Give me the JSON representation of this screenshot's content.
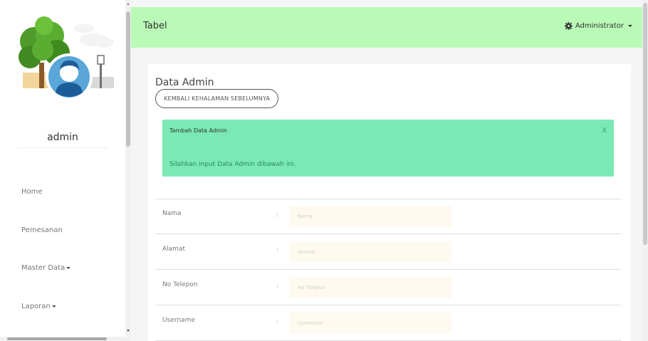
{
  "sidebar": {
    "profile_name": "admin",
    "nav": [
      {
        "label": "Home",
        "has_caret": false
      },
      {
        "label": "Pemesanan",
        "has_caret": false
      },
      {
        "label": "Master Data",
        "has_caret": true
      },
      {
        "label": "Laporan",
        "has_caret": true
      }
    ]
  },
  "topbar": {
    "title": "Tabel",
    "user_label": "Administrator",
    "icon": "gear-icon"
  },
  "panel": {
    "title": "Data Admin",
    "back_button": "KEMBALI KEHALAMAN SEBELUMNYA"
  },
  "alert": {
    "title": "Tambah Data Admin",
    "close": "X",
    "message": "Silahkan input Data Admin dibawah ini."
  },
  "form": {
    "separator": ":",
    "fields": [
      {
        "label": "Nama",
        "placeholder": "Nama",
        "value": ""
      },
      {
        "label": "Alamat",
        "placeholder": "Alamat",
        "value": ""
      },
      {
        "label": "No Telepon",
        "placeholder": "No Telepon",
        "value": ""
      },
      {
        "label": "Username",
        "placeholder": "Username",
        "value": ""
      }
    ]
  },
  "colors": {
    "topbar_bg": "#bafab7",
    "alert_bg": "#7ae9b3",
    "input_bg": "#fffaf0"
  }
}
